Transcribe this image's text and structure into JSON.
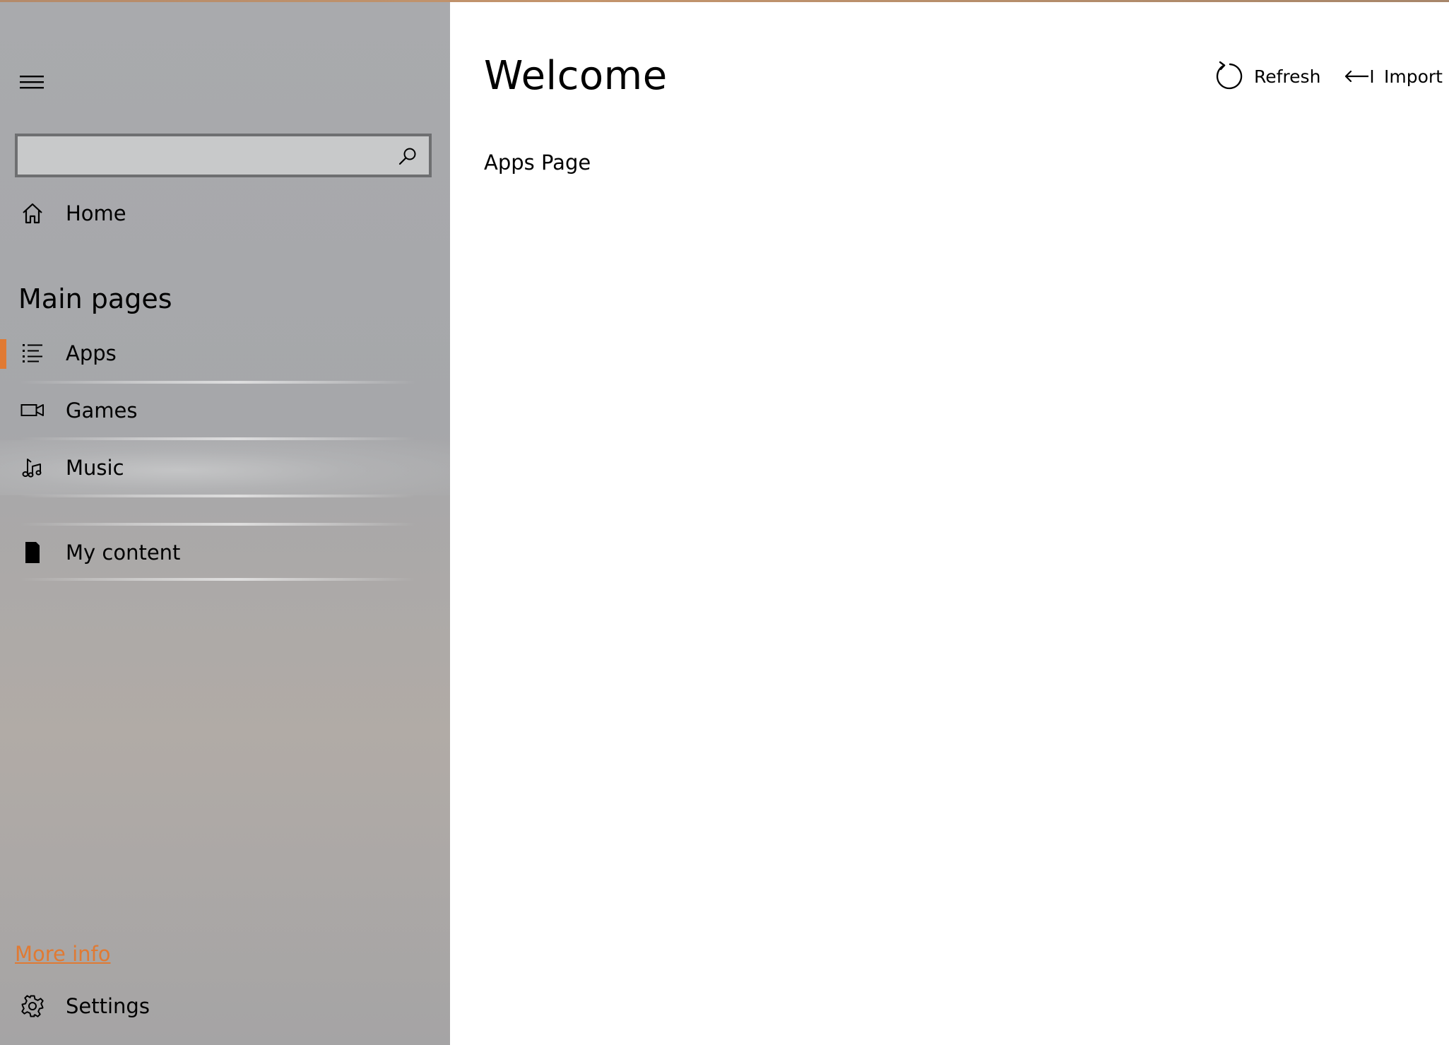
{
  "sidebar": {
    "search": {
      "value": "",
      "placeholder": ""
    },
    "home": {
      "label": "Home",
      "icon": "home-icon"
    },
    "section_header": "Main pages",
    "items": [
      {
        "label": "Apps",
        "icon": "list-icon",
        "selected": true
      },
      {
        "label": "Games",
        "icon": "video-camera-icon",
        "selected": false
      },
      {
        "label": "Music",
        "icon": "music-note-icon",
        "selected": false,
        "hovered": true
      }
    ],
    "my_content": {
      "label": "My content",
      "icon": "bookmark-icon"
    },
    "more_info": "More info",
    "settings": {
      "label": "Settings",
      "icon": "gear-icon"
    },
    "accent_color": "#e07a33"
  },
  "main": {
    "title": "Welcome",
    "subtitle": "Apps Page",
    "toolbar": {
      "refresh_label": "Refresh",
      "import_label": "Import"
    }
  }
}
